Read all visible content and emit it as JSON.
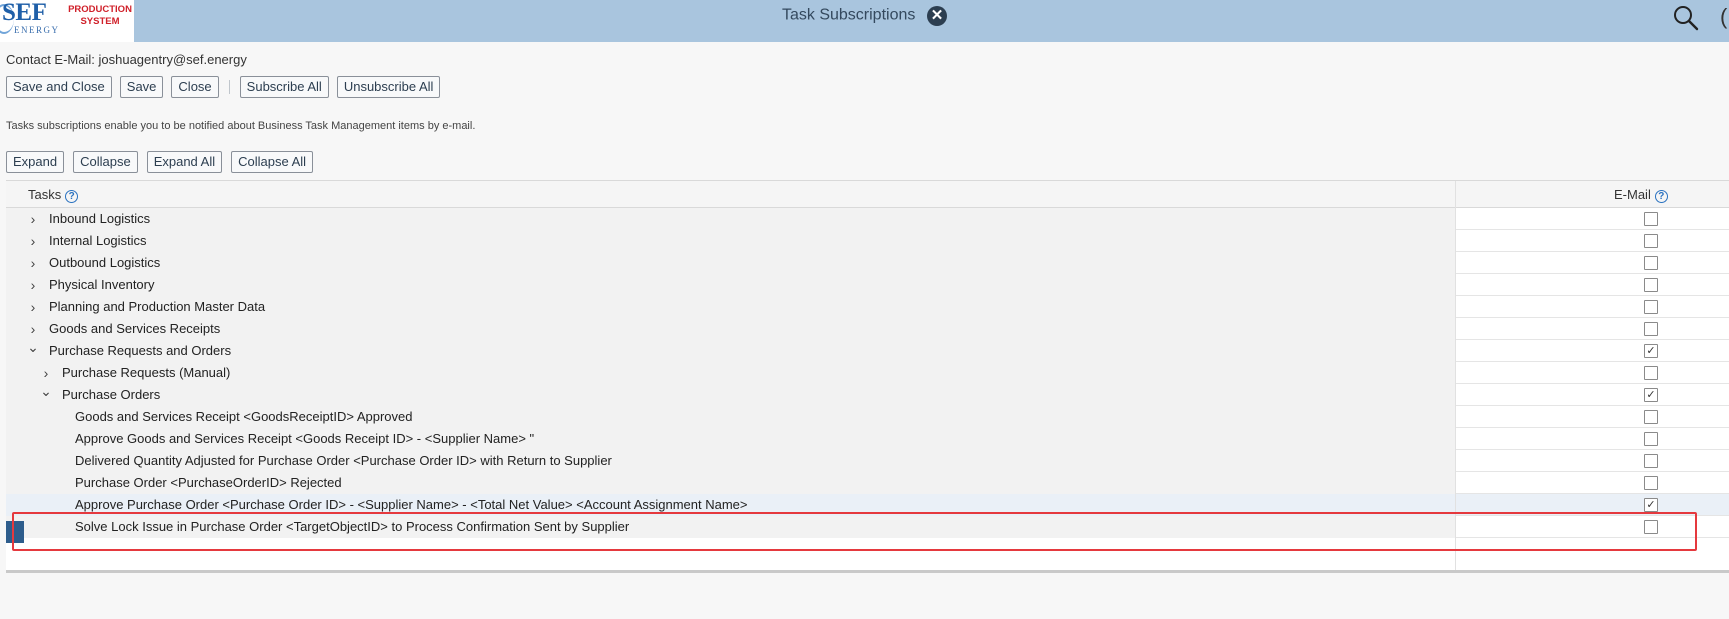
{
  "header": {
    "logo_main": "SEF",
    "logo_sub": "ENERGY",
    "logo_tag_line1": "PRODUCTION",
    "logo_tag_line2": "SYSTEM",
    "title": "Task Subscriptions",
    "close_glyph": "✕",
    "overflow_glyph": "(",
    "icons": [
      "close-circle-icon",
      "search-icon"
    ]
  },
  "contact": {
    "label": "Contact E-Mail:",
    "value": "joshuagentry@sef.energy"
  },
  "toolbar": {
    "save_and_close": "Save and Close",
    "save": "Save",
    "close": "Close",
    "subscribe_all": "Subscribe All",
    "unsubscribe_all": "Unsubscribe All"
  },
  "info_text": "Tasks subscriptions enable you to be notified about Business Task Management items by e-mail.",
  "tree_toolbar": {
    "expand": "Expand",
    "collapse": "Collapse",
    "expand_all": "Expand All",
    "collapse_all": "Collapse All"
  },
  "table": {
    "col_tasks": "Tasks",
    "col_email": "E-Mail",
    "help_glyph": "?",
    "rows": [
      {
        "label": "Inbound Logistics",
        "level": 0,
        "expander": "collapsed",
        "email": false
      },
      {
        "label": "Internal Logistics",
        "level": 0,
        "expander": "collapsed",
        "email": false
      },
      {
        "label": "Outbound Logistics",
        "level": 0,
        "expander": "collapsed",
        "email": false
      },
      {
        "label": "Physical Inventory",
        "level": 0,
        "expander": "collapsed",
        "email": false
      },
      {
        "label": "Planning and Production Master Data",
        "level": 0,
        "expander": "collapsed",
        "email": false
      },
      {
        "label": "Goods and Services Receipts",
        "level": 0,
        "expander": "collapsed",
        "email": false
      },
      {
        "label": "Purchase Requests and Orders",
        "level": 0,
        "expander": "expanded",
        "email": true
      },
      {
        "label": "Purchase Requests (Manual)",
        "level": 1,
        "expander": "collapsed",
        "email": false
      },
      {
        "label": "Purchase Orders",
        "level": 1,
        "expander": "expanded",
        "email": true
      },
      {
        "label": "Goods and Services Receipt <GoodsReceiptID> Approved",
        "level": 2,
        "expander": "none",
        "email": false
      },
      {
        "label": "Approve Goods and Services Receipt <Goods Receipt ID> - <Supplier Name> \"",
        "level": 2,
        "expander": "none",
        "email": false
      },
      {
        "label": "Delivered Quantity Adjusted for Purchase Order <Purchase Order ID> with Return to Supplier",
        "level": 2,
        "expander": "none",
        "email": false
      },
      {
        "label": "Purchase Order <PurchaseOrderID> Rejected",
        "level": 2,
        "expander": "none",
        "email": false
      },
      {
        "label": "Approve Purchase Order <Purchase Order ID> - <Supplier Name> - <Total Net Value> <Account Assignment Name>",
        "level": 2,
        "expander": "none",
        "email": true,
        "selected": true
      },
      {
        "label": "Solve Lock Issue in Purchase Order <TargetObjectID> to Process Confirmation Sent by Supplier",
        "level": 2,
        "expander": "none",
        "email": false
      }
    ]
  },
  "glyphs": {
    "chevron_right": "›",
    "chevron_down": "⌄",
    "check": "✓"
  }
}
